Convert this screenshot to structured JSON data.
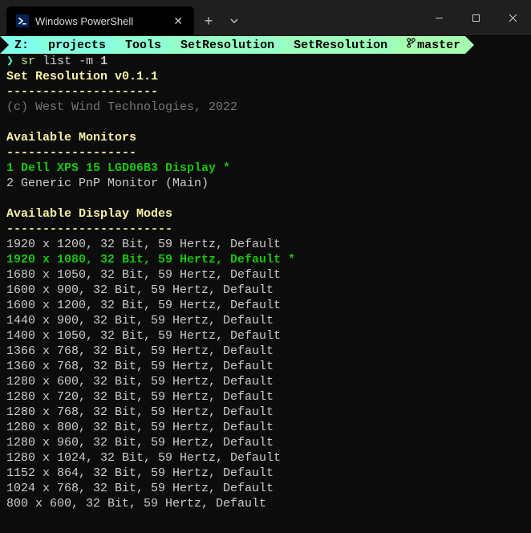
{
  "window": {
    "tab_title": "Windows PowerShell"
  },
  "breadcrumb": {
    "segments": [
      "Z:",
      "projects",
      "Tools",
      "SetResolution",
      "SetResolution"
    ],
    "branch": "master"
  },
  "prompt": {
    "symbol": "❯",
    "cmd": "sr",
    "rest": " list -m ",
    "arg": "1"
  },
  "output": {
    "title": "Set Resolution v0.1.1",
    "rule1": "---------------------",
    "copyright": "(c) West Wind Technologies, 2022",
    "monitors_heading": "Available Monitors",
    "rule2": "------------------",
    "monitors": [
      {
        "text": "1 Dell XPS 15 LGD06B3 Display *",
        "selected": true
      },
      {
        "text": "2 Generic PnP Monitor (Main)",
        "selected": false
      }
    ],
    "modes_heading": "Available Display Modes",
    "rule3": "-----------------------",
    "modes": [
      {
        "text": "1920 x 1200, 32 Bit, 59 Hertz, Default",
        "selected": false
      },
      {
        "text": "1920 x 1080, 32 Bit, 59 Hertz, Default *",
        "selected": true
      },
      {
        "text": "1680 x 1050, 32 Bit, 59 Hertz, Default",
        "selected": false
      },
      {
        "text": "1600 x 900, 32 Bit, 59 Hertz, Default",
        "selected": false
      },
      {
        "text": "1600 x 1200, 32 Bit, 59 Hertz, Default",
        "selected": false
      },
      {
        "text": "1440 x 900, 32 Bit, 59 Hertz, Default",
        "selected": false
      },
      {
        "text": "1400 x 1050, 32 Bit, 59 Hertz, Default",
        "selected": false
      },
      {
        "text": "1366 x 768, 32 Bit, 59 Hertz, Default",
        "selected": false
      },
      {
        "text": "1360 x 768, 32 Bit, 59 Hertz, Default",
        "selected": false
      },
      {
        "text": "1280 x 600, 32 Bit, 59 Hertz, Default",
        "selected": false
      },
      {
        "text": "1280 x 720, 32 Bit, 59 Hertz, Default",
        "selected": false
      },
      {
        "text": "1280 x 768, 32 Bit, 59 Hertz, Default",
        "selected": false
      },
      {
        "text": "1280 x 800, 32 Bit, 59 Hertz, Default",
        "selected": false
      },
      {
        "text": "1280 x 960, 32 Bit, 59 Hertz, Default",
        "selected": false
      },
      {
        "text": "1280 x 1024, 32 Bit, 59 Hertz, Default",
        "selected": false
      },
      {
        "text": "1152 x 864, 32 Bit, 59 Hertz, Default",
        "selected": false
      },
      {
        "text": "1024 x 768, 32 Bit, 59 Hertz, Default",
        "selected": false
      },
      {
        "text": "800 x 600, 32 Bit, 59 Hertz, Default",
        "selected": false
      }
    ]
  }
}
